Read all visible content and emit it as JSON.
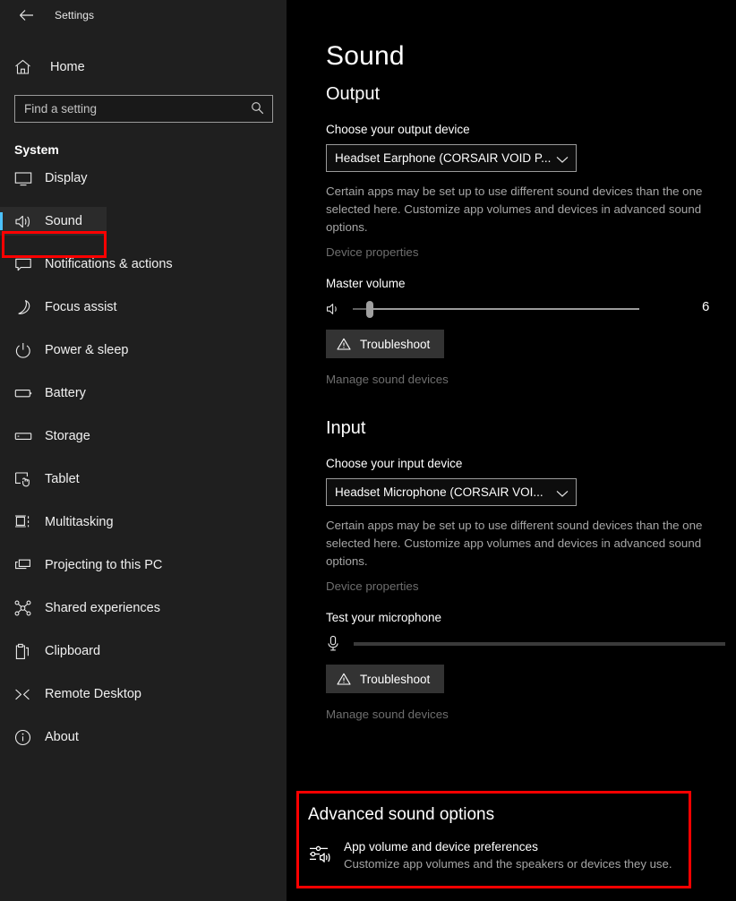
{
  "window": {
    "title": "Settings",
    "back_icon": "back-arrow-icon"
  },
  "sidebar": {
    "home_label": "Home",
    "home_icon": "home-icon",
    "search": {
      "placeholder": "Find a setting",
      "value": "",
      "icon": "search-icon"
    },
    "section_title": "System",
    "selected_item": "Sound",
    "items": [
      {
        "label": "Display",
        "icon": "monitor-icon"
      },
      {
        "label": "Sound",
        "icon": "speaker-icon"
      },
      {
        "label": "Notifications & actions",
        "icon": "chat-bubble-icon"
      },
      {
        "label": "Focus assist",
        "icon": "moon-icon"
      },
      {
        "label": "Power & sleep",
        "icon": "power-icon"
      },
      {
        "label": "Battery",
        "icon": "battery-icon"
      },
      {
        "label": "Storage",
        "icon": "drive-icon"
      },
      {
        "label": "Tablet",
        "icon": "tablet-hand-icon"
      },
      {
        "label": "Multitasking",
        "icon": "multitasking-icon"
      },
      {
        "label": "Projecting to this PC",
        "icon": "project-screen-icon"
      },
      {
        "label": "Shared experiences",
        "icon": "share-nodes-icon"
      },
      {
        "label": "Clipboard",
        "icon": "clipboard-icon"
      },
      {
        "label": "Remote Desktop",
        "icon": "remote-desktop-icon"
      },
      {
        "label": "About",
        "icon": "info-circle-icon"
      }
    ]
  },
  "main": {
    "page_title": "Sound",
    "output": {
      "heading": "Output",
      "device_label": "Choose your output device",
      "device_value": "Headset Earphone (CORSAIR VOID P...",
      "dropdown_icon": "chevron-down-icon",
      "help_text": "Certain apps may be set up to use different sound devices than the one selected here. Customize app volumes and devices in advanced sound options.",
      "device_properties_link": "Device properties",
      "volume_label": "Master volume",
      "volume_icon": "speaker-icon",
      "volume_value": "6",
      "volume_percent": 6,
      "troubleshoot_label": "Troubleshoot",
      "troubleshoot_icon": "warning-triangle-icon",
      "manage_devices_link": "Manage sound devices"
    },
    "input": {
      "heading": "Input",
      "device_label": "Choose your input device",
      "device_value": "Headset Microphone (CORSAIR VOI...",
      "dropdown_icon": "chevron-down-icon",
      "help_text": "Certain apps may be set up to use different sound devices than the one selected here. Customize app volumes and devices in advanced sound options.",
      "device_properties_link": "Device properties",
      "test_label": "Test your microphone",
      "mic_icon": "microphone-icon",
      "mic_level_percent": 0,
      "troubleshoot_label": "Troubleshoot",
      "troubleshoot_icon": "warning-triangle-icon",
      "manage_devices_link": "Manage sound devices"
    },
    "advanced": {
      "heading": "Advanced sound options",
      "item_icon": "app-volume-mixer-icon",
      "item_title": "App volume and device preferences",
      "item_desc": "Customize app volumes and the speakers or devices they use."
    }
  },
  "annotations": {
    "highlight_color": "#ff0000",
    "highlighted_regions": [
      "Sound",
      "Advanced sound options"
    ]
  }
}
